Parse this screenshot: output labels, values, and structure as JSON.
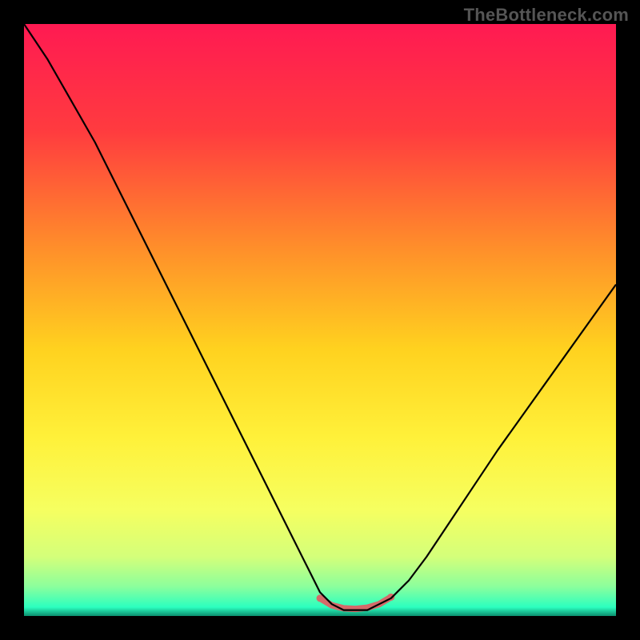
{
  "watermark": "TheBottleneck.com",
  "chart_data": {
    "type": "line",
    "title": "",
    "xlabel": "",
    "ylabel": "",
    "xlim": [
      0,
      100
    ],
    "ylim": [
      0,
      100
    ],
    "grid": false,
    "legend": null,
    "background_gradient": [
      {
        "stop": 0.0,
        "color": "#ff1a52"
      },
      {
        "stop": 0.18,
        "color": "#ff3b3f"
      },
      {
        "stop": 0.38,
        "color": "#ff8f2a"
      },
      {
        "stop": 0.55,
        "color": "#ffd21f"
      },
      {
        "stop": 0.7,
        "color": "#fff13a"
      },
      {
        "stop": 0.82,
        "color": "#f6ff60"
      },
      {
        "stop": 0.9,
        "color": "#d4ff7a"
      },
      {
        "stop": 0.95,
        "color": "#8cff9c"
      },
      {
        "stop": 0.985,
        "color": "#2cffbf"
      },
      {
        "stop": 1.0,
        "color": "#0b8f6f"
      }
    ],
    "series": [
      {
        "name": "bottleneck-curve",
        "stroke": "#000000",
        "stroke_width": 2.2,
        "x": [
          0,
          4,
          8,
          12,
          16,
          20,
          24,
          28,
          32,
          36,
          40,
          44,
          48,
          50,
          52,
          54,
          56,
          58,
          60,
          62,
          65,
          68,
          72,
          76,
          80,
          85,
          90,
          95,
          100
        ],
        "y": [
          100,
          94,
          87,
          80,
          72,
          64,
          56,
          48,
          40,
          32,
          24,
          16,
          8,
          4,
          2,
          1,
          1,
          1,
          2,
          3,
          6,
          10,
          16,
          22,
          28,
          35,
          42,
          49,
          56
        ]
      },
      {
        "name": "optimal-flat-segment",
        "stroke": "#d46a6a",
        "stroke_width": 8,
        "linecap": "round",
        "x": [
          50,
          52,
          54,
          56,
          58,
          60,
          62
        ],
        "y": [
          3.0,
          1.8,
          1.3,
          1.2,
          1.4,
          2.0,
          3.2
        ]
      }
    ],
    "annotations": []
  }
}
